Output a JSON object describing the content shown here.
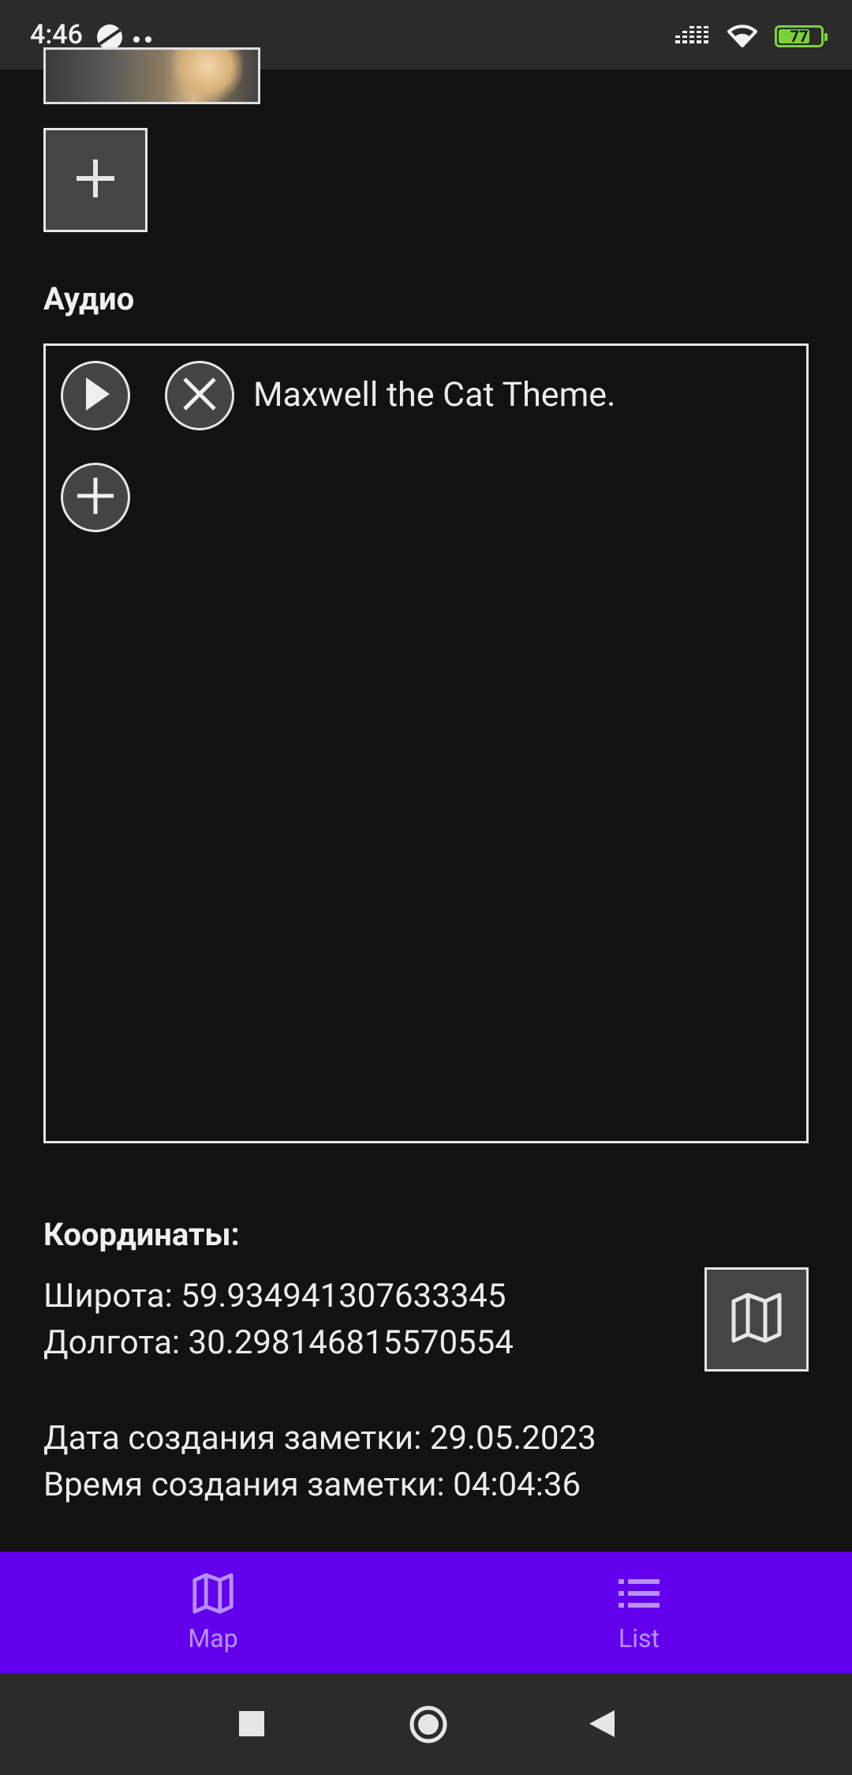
{
  "status_bar": {
    "time": "4:46",
    "battery_percent": "77",
    "battery_level": 0.77,
    "icons": [
      "planet-icon",
      "dots-icon",
      "signal-icon",
      "wifi-icon",
      "battery-icon"
    ]
  },
  "photos": {
    "add_label_icon": "plus-icon"
  },
  "audio": {
    "title": "Аудио",
    "items": [
      {
        "name": "Maxwell the Cat Theme."
      }
    ]
  },
  "coordinates": {
    "title": "Координаты:",
    "latitude": "Широта: 59.934941307633345",
    "longitude": "Долгота: 30.298146815570554",
    "map_button_icon": "map-icon"
  },
  "note_meta": {
    "created_date": "Дата создания заметки: 29.05.2023",
    "created_time": "Время создания заметки: 04:04:36"
  },
  "bottom_nav": {
    "items": [
      {
        "label": "Map",
        "icon": "map-icon"
      },
      {
        "label": "List",
        "icon": "list-icon"
      }
    ],
    "background": "#6200ee",
    "inactive_color": "#b790ff"
  },
  "colors": {
    "background": "#121212",
    "surface_button": "#454545",
    "border": "#e6e6e6",
    "text": "#ececec"
  }
}
